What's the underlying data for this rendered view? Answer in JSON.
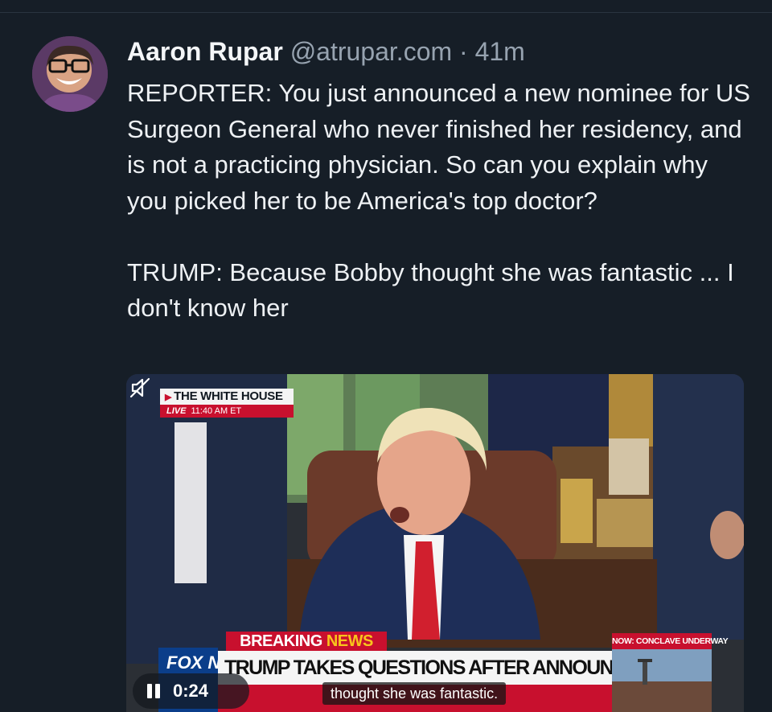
{
  "post": {
    "author_name": "Aaron Rupar",
    "author_handle": "@atrupar.com",
    "separator": "·",
    "timestamp": "41m",
    "text": "REPORTER: You just announced a new nominee for US Surgeon General who never finished her residency, and is not a practicing physician. So can you explain why you picked her to be America's top doctor?\n\nTRUMP: Because Bobby thought she was fantastic ... I don't know her"
  },
  "video": {
    "location_label": "THE WHITE HOUSE",
    "live_label": "LIVE",
    "live_time": "11:40 AM ET",
    "breaking_label": "BREAKING",
    "breaking_news": "NEWS",
    "headline": "TRUMP TAKES QUESTIONS AFTER ANNOUNCING TRADE DEAL",
    "side_label": "NOW: CONCLAVE UNDERWAY",
    "network": "FOX NEWS",
    "elapsed": "0:24",
    "caption": "thought she was fantastic.",
    "play_state_icon": "pause-icon",
    "audio_icon": "muted-speaker-icon"
  },
  "colors": {
    "background": "#161e27",
    "muted_text": "#97a3b0",
    "fox_red": "#c8102e",
    "fox_blue": "#0b3e8a"
  }
}
